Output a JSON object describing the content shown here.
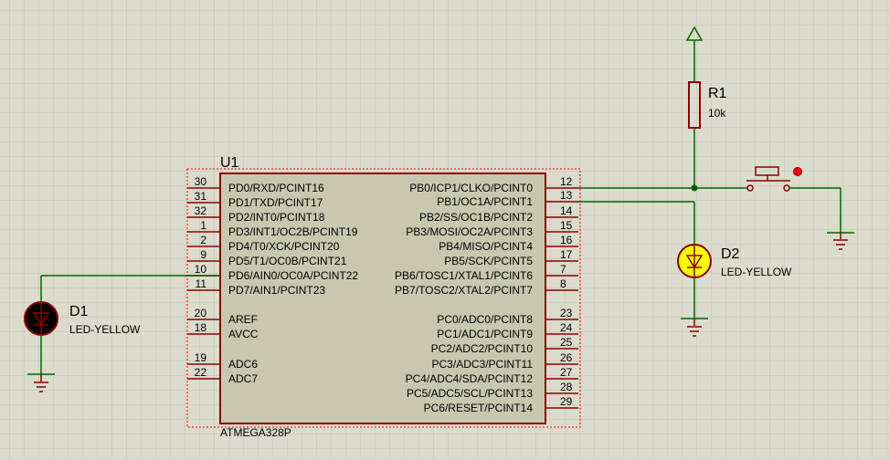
{
  "u1": {
    "ref": "U1",
    "part": "ATMEGA328P",
    "left_pins": [
      {
        "num": "30",
        "name": "PD0/RXD/PCINT16"
      },
      {
        "num": "31",
        "name": "PD1/TXD/PCINT17"
      },
      {
        "num": "32",
        "name": "PD2/INT0/PCINT18"
      },
      {
        "num": "1",
        "name": "PD3/INT1/OC2B/PCINT19"
      },
      {
        "num": "2",
        "name": "PD4/T0/XCK/PCINT20"
      },
      {
        "num": "9",
        "name": "PD5/T1/OC0B/PCINT21"
      },
      {
        "num": "10",
        "name": "PD6/AIN0/OC0A/PCINT22"
      },
      {
        "num": "11",
        "name": "PD7/AIN1/PCINT23"
      },
      {
        "num": "20",
        "name": "AREF"
      },
      {
        "num": "18",
        "name": "AVCC"
      },
      {
        "num": "19",
        "name": "ADC6"
      },
      {
        "num": "22",
        "name": "ADC7"
      }
    ],
    "right_pins": [
      {
        "num": "12",
        "name": "PB0/ICP1/CLKO/PCINT0"
      },
      {
        "num": "13",
        "name": "PB1/OC1A/PCINT1"
      },
      {
        "num": "14",
        "name": "PB2/SS/OC1B/PCINT2"
      },
      {
        "num": "15",
        "name": "PB3/MOSI/OC2A/PCINT3"
      },
      {
        "num": "16",
        "name": "PB4/MISO/PCINT4"
      },
      {
        "num": "17",
        "name": "PB5/SCK/PCINT5"
      },
      {
        "num": "7",
        "name": "PB6/TOSC1/XTAL1/PCINT6"
      },
      {
        "num": "8",
        "name": "PB7/TOSC2/XTAL2/PCINT7"
      },
      {
        "num": "23",
        "name": "PC0/ADC0/PCINT8"
      },
      {
        "num": "24",
        "name": "PC1/ADC1/PCINT9"
      },
      {
        "num": "25",
        "name": "PC2/ADC2/PCINT10"
      },
      {
        "num": "26",
        "name": "PC3/ADC3/PCINT11"
      },
      {
        "num": "27",
        "name": "PC4/ADC4/SDA/PCINT12"
      },
      {
        "num": "28",
        "name": "PC5/ADC5/SCL/PCINT13"
      },
      {
        "num": "29",
        "name": "PC6/RESET/PCINT14"
      }
    ]
  },
  "d1": {
    "ref": "D1",
    "value": "LED-YELLOW"
  },
  "d2": {
    "ref": "D2",
    "value": "LED-YELLOW"
  },
  "r1": {
    "ref": "R1",
    "value": "10k"
  },
  "colors": {
    "background": "#dcdccc",
    "grid": "#c6c6b6",
    "wire": "#006400",
    "component": "#8b0000",
    "chip_fill": "#c8c8b0",
    "selection": "#ff0000",
    "led_lit": "#ffff00",
    "led_off": "#000000"
  }
}
